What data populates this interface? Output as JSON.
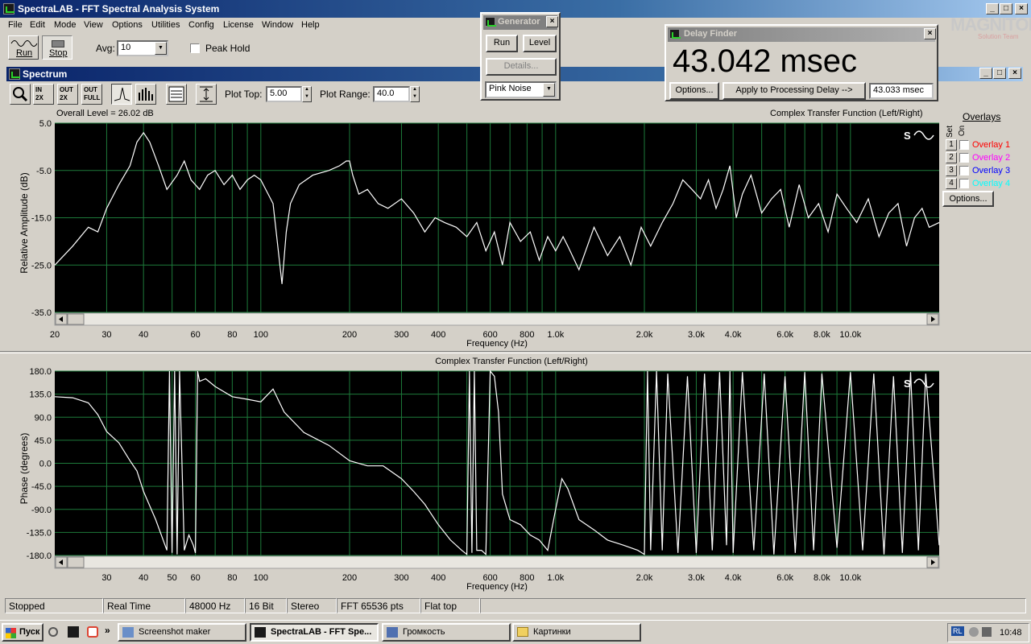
{
  "window": {
    "title": "SpectraLAB - FFT Spectral Analysis System"
  },
  "menu": [
    "File",
    "Edit",
    "Mode",
    "View",
    "Options",
    "Utilities",
    "Config",
    "License",
    "Window",
    "Help"
  ],
  "toolbar": {
    "run_label": "Run",
    "stop_label": "Stop",
    "avg_label": "Avg:",
    "avg_value": "10",
    "peak_hold_label": "Peak Hold"
  },
  "generator": {
    "title": "Generator",
    "run_label": "Run",
    "level_label": "Level",
    "details_label": "Details...",
    "noise_value": "Pink Noise"
  },
  "delay_finder": {
    "title": "Delay Finder",
    "value": "43.042 msec",
    "options_label": "Options...",
    "apply_label": "Apply to Processing Delay -->",
    "result": "43.033 msec"
  },
  "watermark": {
    "brand": "MAGNITOLA",
    "sub": "Solution Team"
  },
  "spectrum": {
    "title": "Spectrum",
    "plot_top_label": "Plot Top:",
    "plot_top_value": "5.00",
    "plot_range_label": "Plot Range:",
    "plot_range_value": "40.0",
    "overall_level": "Overall Level = 26.02 dB",
    "mag_title": "Complex Transfer Function (Left/Right)",
    "phase_title": "Complex Transfer Function (Left/Right)",
    "mag_ylabel": "Relative Amplitude (dB)",
    "phase_ylabel": "Phase (degrees)",
    "xlabel": "Frequency (Hz)"
  },
  "overlays": {
    "title": "Overlays",
    "set_label": "Set",
    "on_label": "On",
    "items": [
      {
        "num": "1",
        "name": "Overlay 1",
        "color": "#ff0000"
      },
      {
        "num": "2",
        "name": "Overlay 2",
        "color": "#ff00ff"
      },
      {
        "num": "3",
        "name": "Overlay 3",
        "color": "#0000ff"
      },
      {
        "num": "4",
        "name": "Overlay 4",
        "color": "#00ffff"
      }
    ],
    "options_label": "Options..."
  },
  "status": [
    "Stopped",
    "Real Time",
    "48000 Hz",
    "16 Bit",
    "Stereo",
    "FFT 65536 pts",
    "Flat top"
  ],
  "taskbar": {
    "start_label": "Пуск",
    "tasks": [
      "Screenshot maker",
      "SpectraLAB - FFT Spe...",
      "Громкость",
      "Картинки"
    ],
    "lang": "RL",
    "clock": "10:48"
  },
  "chart_data": [
    {
      "type": "line",
      "title": "Complex Transfer Function (Left/Right)",
      "xlabel": "Frequency (Hz)",
      "ylabel": "Relative Amplitude (dB)",
      "xscale": "log",
      "xlim": [
        20,
        20000
      ],
      "ylim": [
        -35,
        5
      ],
      "yticks": [
        5.0,
        -5.0,
        -15.0,
        -25.0,
        -35.0
      ],
      "xtick_labels": [
        "20",
        "30",
        "40",
        "60",
        "80",
        "100",
        "200",
        "300",
        "400",
        "600",
        "800",
        "1.0k",
        "2.0k",
        "3.0k",
        "4.0k",
        "6.0k",
        "8.0k",
        "10.0k"
      ],
      "xtick_values": [
        20,
        30,
        40,
        60,
        80,
        100,
        200,
        300,
        400,
        600,
        800,
        1000,
        2000,
        3000,
        4000,
        6000,
        8000,
        10000
      ],
      "grid": true,
      "series": [
        {
          "color": "#ffffff",
          "x": [
            20,
            23,
            26,
            28,
            30,
            33,
            36,
            38,
            40,
            42,
            45,
            48,
            52,
            55,
            58,
            62,
            66,
            70,
            75,
            80,
            85,
            90,
            95,
            100,
            110,
            118,
            122,
            126,
            135,
            150,
            170,
            185,
            195,
            200,
            205,
            215,
            230,
            250,
            270,
            300,
            330,
            360,
            390,
            420,
            460,
            500,
            540,
            580,
            620,
            660,
            700,
            760,
            820,
            880,
            940,
            1000,
            1060,
            1100,
            1200,
            1350,
            1500,
            1650,
            1800,
            1950,
            2100,
            2300,
            2500,
            2700,
            2900,
            3100,
            3300,
            3500,
            3700,
            3900,
            4100,
            4300,
            4600,
            5000,
            5400,
            5800,
            6200,
            6700,
            7200,
            7800,
            8400,
            9000,
            9700,
            10500,
            11500,
            12500,
            13500,
            14500,
            15500,
            16500,
            17500,
            18500,
            20000
          ],
          "y": [
            -25,
            -21,
            -17,
            -18,
            -13,
            -8,
            -4,
            1,
            3,
            1,
            -4,
            -9,
            -6,
            -3,
            -7,
            -9,
            -6,
            -5,
            -8,
            -6,
            -9,
            -7,
            -6,
            -7,
            -12,
            -29,
            -18,
            -12,
            -8,
            -6,
            -5,
            -4,
            -3,
            -3,
            -6,
            -10,
            -9,
            -12,
            -13,
            -11,
            -14,
            -18,
            -15,
            -16,
            -17,
            -19,
            -16,
            -22,
            -18,
            -25,
            -16,
            -20,
            -18,
            -24,
            -19,
            -22,
            -19,
            -21,
            -26,
            -17,
            -23,
            -19,
            -25,
            -17,
            -21,
            -16,
            -12,
            -7,
            -9,
            -11,
            -7,
            -13,
            -9,
            -4,
            -15,
            -10,
            -6,
            -14,
            -11,
            -9,
            -17,
            -8,
            -15,
            -12,
            -18,
            -10,
            -13,
            -16,
            -11,
            -19,
            -14,
            -12,
            -21,
            -15,
            -13,
            -17,
            -16
          ]
        }
      ]
    },
    {
      "type": "line",
      "title": "Complex Transfer Function (Left/Right)",
      "xlabel": "Frequency (Hz)",
      "ylabel": "Phase (degrees)",
      "xscale": "log",
      "xlim": [
        20,
        20000
      ],
      "ylim": [
        -180,
        180
      ],
      "yticks": [
        180.0,
        135.0,
        90.0,
        45.0,
        0.0,
        -45.0,
        -90.0,
        -135.0,
        -180.0
      ],
      "xtick_labels": [
        "30",
        "40",
        "50",
        "60",
        "80",
        "100",
        "200",
        "300",
        "400",
        "600",
        "800",
        "1.0k",
        "2.0k",
        "3.0k",
        "4.0k",
        "6.0k",
        "8.0k",
        "10.0k"
      ],
      "xtick_values": [
        30,
        40,
        50,
        60,
        80,
        100,
        200,
        300,
        400,
        600,
        800,
        1000,
        2000,
        3000,
        4000,
        6000,
        8000,
        10000
      ],
      "grid": true,
      "series": [
        {
          "color": "#ffffff",
          "x": [
            20,
            23,
            26,
            28,
            30,
            33,
            36,
            38,
            40,
            44,
            48,
            49,
            50,
            51,
            52,
            53,
            55,
            57,
            59,
            60,
            61,
            62,
            65,
            70,
            80,
            90,
            100,
            110,
            120,
            140,
            170,
            200,
            230,
            260,
            300,
            330,
            360,
            400,
            440,
            480,
            500,
            510,
            520,
            530,
            540,
            560,
            580,
            600,
            620,
            640,
            660,
            700,
            760,
            820,
            880,
            940,
            1000,
            1050,
            1100,
            1200,
            1350,
            1500,
            1700,
            1900,
            2000,
            2050,
            2100,
            2200,
            2300,
            2400,
            2600,
            2800,
            3000,
            3200,
            3400,
            3600,
            3800,
            3900,
            4000,
            4300,
            4700,
            5100,
            5500,
            6000,
            6500,
            7000,
            7500,
            8000,
            9000,
            10000,
            11000,
            12000,
            13000,
            14000,
            15000,
            16000,
            17000,
            18000,
            20000
          ],
          "y": [
            130,
            128,
            118,
            95,
            62,
            40,
            5,
            -15,
            -55,
            -110,
            -170,
            180,
            -175,
            180,
            -178,
            180,
            -170,
            -140,
            -160,
            -175,
            180,
            160,
            165,
            150,
            130,
            125,
            120,
            145,
            100,
            60,
            35,
            5,
            -5,
            -5,
            -30,
            -55,
            -80,
            -120,
            -150,
            -170,
            -178,
            180,
            -175,
            180,
            -170,
            -170,
            -178,
            180,
            170,
            100,
            -60,
            -110,
            -120,
            -140,
            -150,
            -170,
            -90,
            -30,
            -50,
            -110,
            -130,
            -150,
            -160,
            -170,
            -178,
            180,
            -170,
            180,
            -170,
            175,
            -175,
            170,
            -175,
            175,
            -170,
            178,
            -160,
            180,
            -175,
            178,
            -170,
            175,
            -178,
            170,
            -175,
            178,
            -170,
            175,
            -165,
            178,
            -170,
            175,
            -178,
            170,
            -175,
            178,
            -170,
            175,
            -160
          ]
        }
      ]
    }
  ]
}
